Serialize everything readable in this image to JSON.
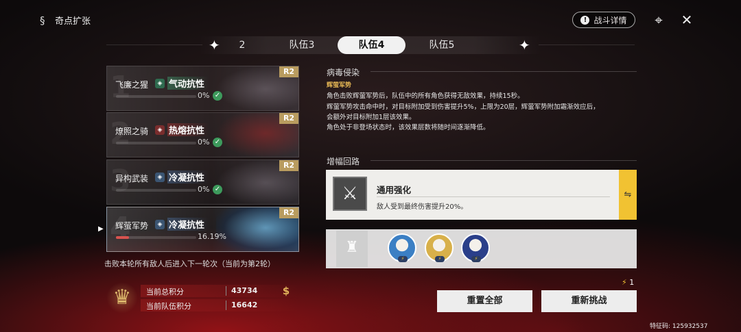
{
  "header": {
    "title": "奇点扩张",
    "battle_detail_label": "战斗详情",
    "info_glyph": "!"
  },
  "icons": {
    "title_icon": "s-curve-icon",
    "target_icon": "crosshair-icon",
    "close_icon": "close-icon",
    "coin_icon": "s-coin-icon",
    "trophy_icon": "trophy-icon"
  },
  "tabs": [
    {
      "label": "2",
      "active": false
    },
    {
      "label": "队伍3",
      "active": false
    },
    {
      "label": "队伍4",
      "active": true
    },
    {
      "label": "队伍5",
      "active": false
    }
  ],
  "enemies": [
    {
      "index": "1",
      "name": "飞廉之猩",
      "resistance": "气动抗性",
      "resistance_color": "green",
      "rank": "R2",
      "progress_text": "0%",
      "progress_value": 0,
      "cleared": true
    },
    {
      "index": "2",
      "name": "燎照之骑",
      "resistance": "热熔抗性",
      "resistance_color": "red",
      "rank": "R2",
      "progress_text": "0%",
      "progress_value": 0,
      "cleared": true
    },
    {
      "index": "3",
      "name": "异构武装",
      "resistance": "冷凝抗性",
      "resistance_color": "blue",
      "rank": "R2",
      "progress_text": "0%",
      "progress_value": 0,
      "cleared": true
    },
    {
      "index": "4",
      "name": "辉萤军势",
      "resistance": "冷凝抗性",
      "resistance_color": "blue",
      "rank": "R2",
      "progress_text": "16.19%",
      "progress_value": 16.19,
      "cleared": false
    }
  ],
  "round_note": "击败本轮所有敌人后进入下一轮次（当前为第2轮）",
  "scores": {
    "total_label": "当前总积分",
    "total_value": "43734",
    "team_label": "当前队伍积分",
    "team_value": "16642"
  },
  "virus": {
    "section_title": "病毒侵染",
    "buff_name": "辉萤军势",
    "lines": [
      "角色击败辉萤军势后，队伍中的所有角色获得无敌效果，持续15秒。",
      "辉萤军势攻击命中时，对目标附加受到伤害提升5%，上限为20层，辉萤军势附加霜渐效应后，",
      "会额外对目标附加1层该效果。",
      "角色处于非登场状态时，该效果层数将随时间逐渐降低。"
    ]
  },
  "amplify": {
    "section_title": "增幅回路",
    "card_title": "通用强化",
    "card_desc": "敌人受到最终伤害提升20%。",
    "swap_glyph": "⇋"
  },
  "team": {
    "members": [
      {
        "name": "avatar-1",
        "color": "#3b7fc4"
      },
      {
        "name": "avatar-2",
        "color": "#d8b04a"
      },
      {
        "name": "avatar-3",
        "color": "#2a3f8a"
      }
    ]
  },
  "energy": {
    "value": "1"
  },
  "buttons": {
    "reset_all": "重置全部",
    "retry": "重新挑战"
  },
  "uid_text": "特征码: 125932537"
}
